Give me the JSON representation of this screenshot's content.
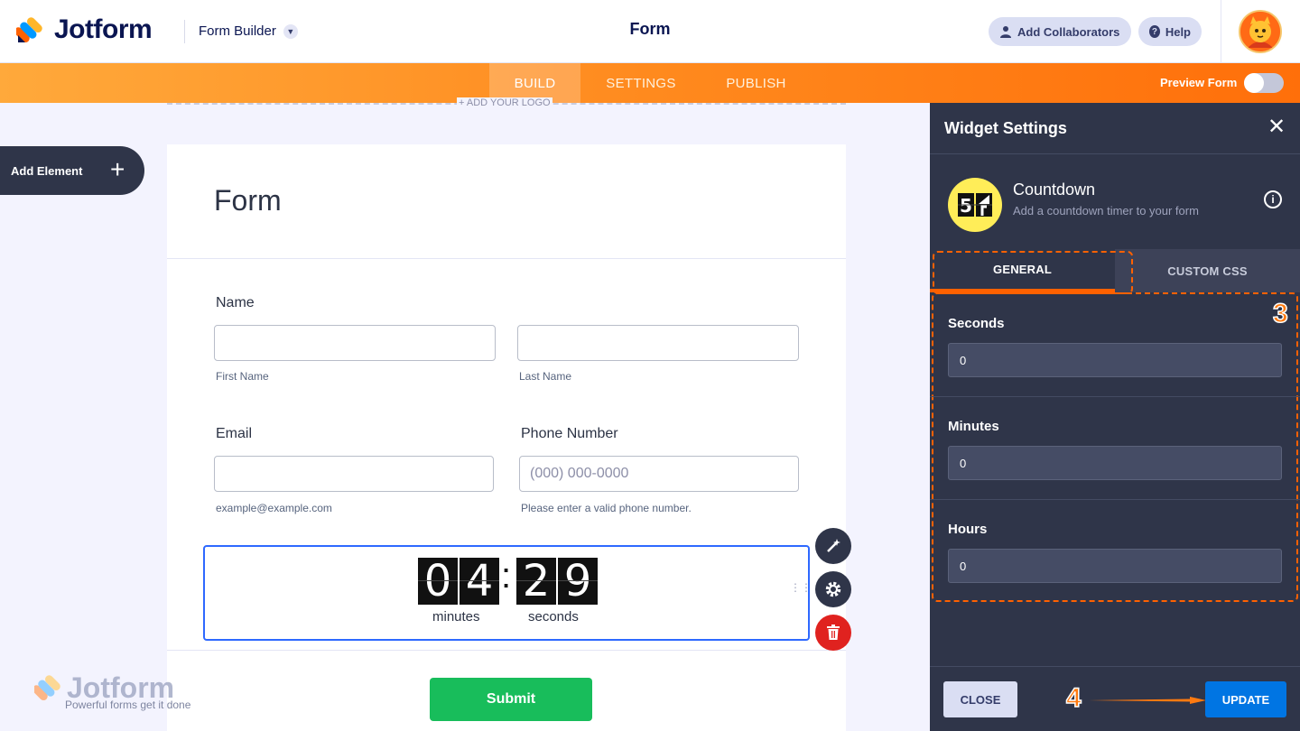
{
  "header": {
    "logo_text": "Jotform",
    "builder_label": "Form Builder",
    "page_title": "Form",
    "add_collaborators": "Add Collaborators",
    "help": "Help"
  },
  "nav": {
    "tabs": [
      {
        "label": "BUILD",
        "active": true
      },
      {
        "label": "SETTINGS",
        "active": false
      },
      {
        "label": "PUBLISH",
        "active": false
      }
    ],
    "preview_label": "Preview Form"
  },
  "canvas": {
    "add_logo": "+ ADD YOUR LOGO",
    "add_element": "Add Element"
  },
  "form": {
    "title": "Form",
    "name_label": "Name",
    "first_name_sub": "First Name",
    "last_name_sub": "Last Name",
    "email_label": "Email",
    "email_sub": "example@example.com",
    "phone_label": "Phone Number",
    "phone_placeholder": "(000) 000-0000",
    "phone_sub": "Please enter a valid phone number.",
    "countdown": {
      "digits": [
        "0",
        "4",
        "2",
        "9"
      ],
      "minutes_label": "minutes",
      "seconds_label": "seconds"
    },
    "submit_label": "Submit"
  },
  "watermark": {
    "text": "Jotform",
    "tagline": "Powerful forms get it done"
  },
  "panel": {
    "title": "Widget Settings",
    "widget_name": "Countdown",
    "widget_desc": "Add a countdown timer to your form",
    "tabs": [
      "GENERAL",
      "CUSTOM CSS"
    ],
    "fields": [
      {
        "label": "Seconds",
        "value": "0"
      },
      {
        "label": "Minutes",
        "value": "0"
      },
      {
        "label": "Hours",
        "value": "0"
      }
    ],
    "close_label": "CLOSE",
    "update_label": "UPDATE"
  },
  "annotations": {
    "step3": "3",
    "step4": "4"
  },
  "colors": {
    "accent_orange": "#ff6100",
    "panel_bg": "#2f3549",
    "update_blue": "#0075e3",
    "submit_green": "#18bd5b",
    "selection_blue": "#2e69ff"
  },
  "icons": [
    "jotform-logo-icon",
    "chevron-down-icon",
    "user-icon",
    "help-icon",
    "avatar",
    "plus-icon",
    "magic-wand-icon",
    "gear-icon",
    "trash-icon",
    "drag-handle-icon",
    "close-icon",
    "countdown-widget-icon",
    "info-icon"
  ]
}
